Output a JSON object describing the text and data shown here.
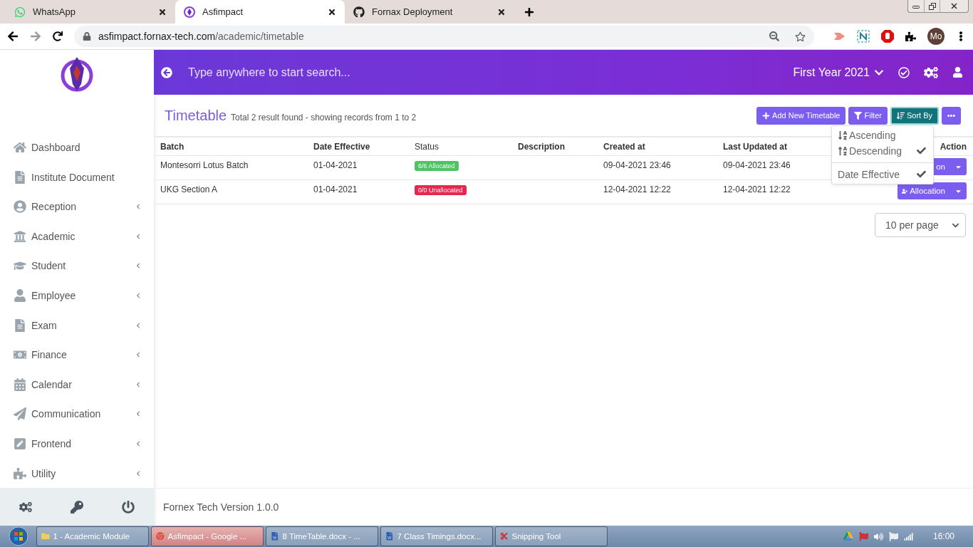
{
  "browser": {
    "tabs": [
      {
        "title": "WhatsApp",
        "selected": false
      },
      {
        "title": "Asfimpact",
        "selected": true
      },
      {
        "title": "Fornax Deployment",
        "selected": false
      }
    ],
    "address": {
      "host": "asfimpact.fornax-tech.com",
      "path": "/academic/timetable"
    },
    "avatar": "Mo"
  },
  "sidebar": {
    "items": [
      {
        "label": "Dashboard",
        "submenu": false
      },
      {
        "label": "Institute Document",
        "submenu": false
      },
      {
        "label": "Reception",
        "submenu": true
      },
      {
        "label": "Academic",
        "submenu": true
      },
      {
        "label": "Student",
        "submenu": true
      },
      {
        "label": "Employee",
        "submenu": true
      },
      {
        "label": "Exam",
        "submenu": true
      },
      {
        "label": "Finance",
        "submenu": true
      },
      {
        "label": "Calendar",
        "submenu": true
      },
      {
        "label": "Communication",
        "submenu": true
      },
      {
        "label": "Frontend",
        "submenu": true
      },
      {
        "label": "Utility",
        "submenu": true
      }
    ]
  },
  "header": {
    "search_placeholder": "Type anywhere to start search...",
    "session": "First Year 2021"
  },
  "page": {
    "title": "Timetable",
    "summary": "Total 2 result found - showing records from 1 to 2",
    "buttons": [
      {
        "label": "Add New Timetable",
        "kind": "add",
        "active": false
      },
      {
        "label": "Filter",
        "kind": "filter",
        "active": false
      },
      {
        "label": "Sort By",
        "kind": "sort",
        "active": true
      },
      {
        "kind": "more",
        "active": false
      }
    ],
    "sort_menu": [
      {
        "label": "Ascending",
        "kind": "asc",
        "checked": false
      },
      {
        "label": "Descending",
        "kind": "desc",
        "checked": true
      },
      {
        "label": "Date Effective",
        "kind": "field",
        "checked": true
      }
    ],
    "table": {
      "columns": [
        "Batch",
        "Date Effective",
        "Status",
        "Description",
        "Created at",
        "Last Updated at",
        "Action"
      ],
      "rows": [
        {
          "batch": "Montesorri Lotus Batch",
          "date_effective": "01-04-2021",
          "status": "6/6 Allocated",
          "allocated": true,
          "created_at": "09-04-2021 23:46",
          "updated_at": "09-04-2021 23:46",
          "action": "on",
          "action_icon": false
        },
        {
          "batch": "UKG Section A",
          "date_effective": "01-04-2021",
          "status": "0/0 Unallocated",
          "allocated": false,
          "created_at": "12-04-2021 12:22",
          "updated_at": "12-04-2021 12:22",
          "action": "Allocation",
          "action_icon": true
        }
      ]
    },
    "per_page": "10 per page",
    "footer": "Fornex Tech Version 1.0.0"
  },
  "taskbar": {
    "items": [
      {
        "label": "1 - Academic Module",
        "kind": "folder",
        "selected": false
      },
      {
        "label": "Asfimpact - Google ...",
        "kind": "chrome",
        "selected": true
      },
      {
        "label": "8 TimeTable.docx - ...",
        "kind": "word",
        "selected": false
      },
      {
        "label": "7 Class Timings.docx...",
        "kind": "word",
        "selected": false
      },
      {
        "label": "Snipping Tool",
        "kind": "snip",
        "selected": false
      }
    ],
    "time": "16:00"
  }
}
